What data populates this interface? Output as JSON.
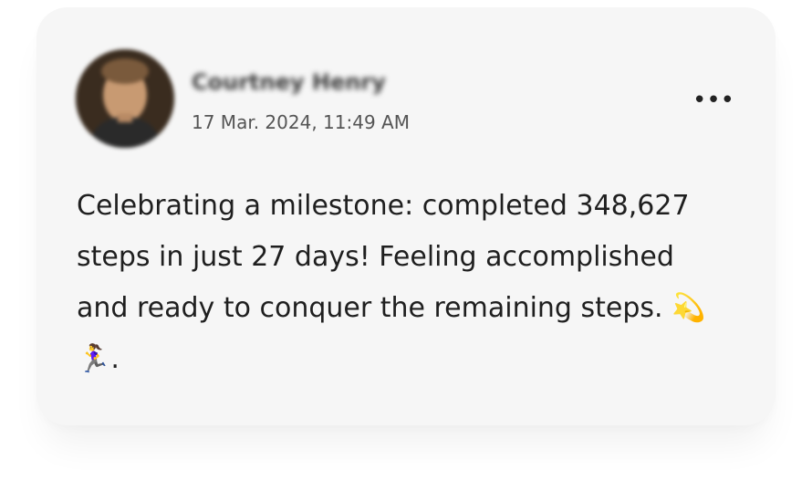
{
  "post": {
    "author": "Courtney Henry",
    "timestamp": "17 Mar. 2024, 11:49 AM",
    "more_icon": "•••",
    "body": "Celebrating a milestone: completed 348,627 steps in just 27 days! Feeling accomplished and ready to conquer the remaining steps. 💫🏃‍♀️."
  },
  "colors": {
    "card_background": "#f6f6f6",
    "text": "#1f1f1f",
    "meta_text": "#555555"
  }
}
